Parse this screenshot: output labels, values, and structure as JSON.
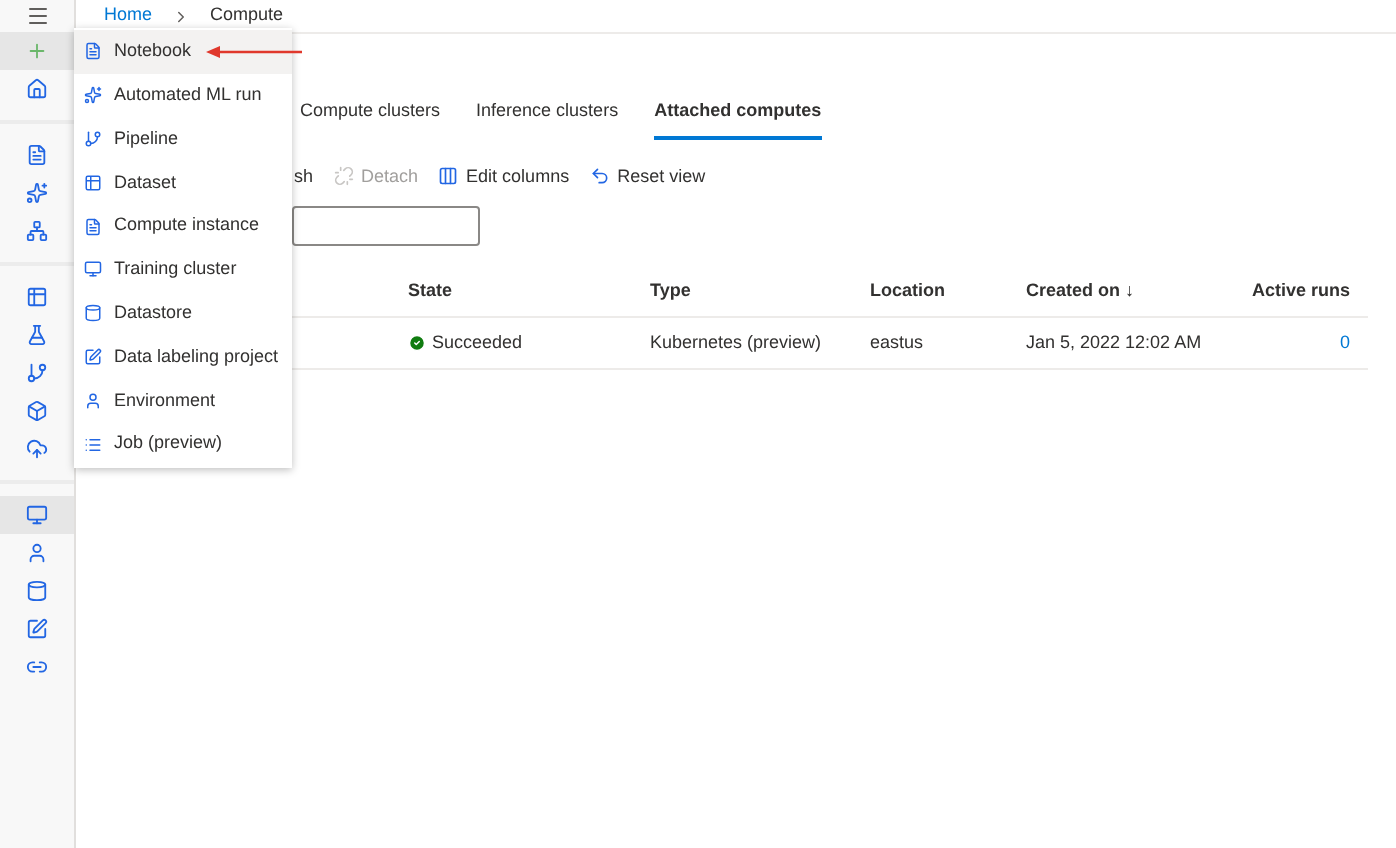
{
  "breadcrumb": [
    {
      "label": "Home",
      "link": true
    },
    {
      "label": "Compute",
      "link": false
    }
  ],
  "rail": {
    "groups": [
      [
        {
          "kind": "plus",
          "selected": true
        },
        {
          "kind": "home",
          "selected": false
        }
      ],
      [
        {
          "kind": "notebook",
          "selected": false
        },
        {
          "kind": "automl",
          "selected": false
        },
        {
          "kind": "designer",
          "selected": false
        }
      ],
      [
        {
          "kind": "datasets",
          "selected": false
        },
        {
          "kind": "experiments",
          "selected": false
        },
        {
          "kind": "pipelines",
          "selected": false
        },
        {
          "kind": "models",
          "selected": false
        },
        {
          "kind": "endpoints",
          "selected": false
        }
      ],
      [
        {
          "kind": "compute",
          "selected": true
        },
        {
          "kind": "environments",
          "selected": false
        },
        {
          "kind": "datastores",
          "selected": false
        },
        {
          "kind": "labeling",
          "selected": false
        },
        {
          "kind": "linked",
          "selected": false
        }
      ]
    ]
  },
  "tabs": [
    {
      "label": "Compute clusters",
      "selected": false
    },
    {
      "label": "Inference clusters",
      "selected": false
    },
    {
      "label": "Attached computes",
      "selected": true
    }
  ],
  "toolbar": [
    {
      "kind": "partial",
      "label": "sh",
      "disabled": false
    },
    {
      "kind": "detach",
      "label": "Detach",
      "disabled": true
    },
    {
      "kind": "columns",
      "label": "Edit columns",
      "disabled": false
    },
    {
      "kind": "reset",
      "label": "Reset view",
      "disabled": false
    }
  ],
  "table": {
    "columns": [
      "State",
      "Type",
      "Location",
      "Created on ↓",
      "Active runs"
    ],
    "rows": [
      {
        "state": "Succeeded",
        "type": "Kubernetes (preview)",
        "location": "eastus",
        "created_on": "Jan 5, 2022 12:02 AM",
        "active_runs": "0"
      }
    ]
  },
  "new_menu": {
    "items": [
      {
        "kind": "notebook",
        "label": "Notebook",
        "selected": true
      },
      {
        "kind": "automl",
        "label": "Automated ML run",
        "selected": false
      },
      {
        "kind": "pipeline",
        "label": "Pipeline",
        "selected": false
      },
      {
        "kind": "dataset",
        "label": "Dataset",
        "selected": false
      },
      {
        "kind": "instance",
        "label": "Compute instance",
        "selected": false
      },
      {
        "kind": "cluster",
        "label": "Training cluster",
        "selected": false
      },
      {
        "kind": "datastore",
        "label": "Datastore",
        "selected": false
      },
      {
        "kind": "labeling",
        "label": "Data labeling project",
        "selected": false
      },
      {
        "kind": "environment",
        "label": "Environment",
        "selected": false
      },
      {
        "kind": "job",
        "label": "Job (preview)",
        "selected": false
      }
    ]
  }
}
